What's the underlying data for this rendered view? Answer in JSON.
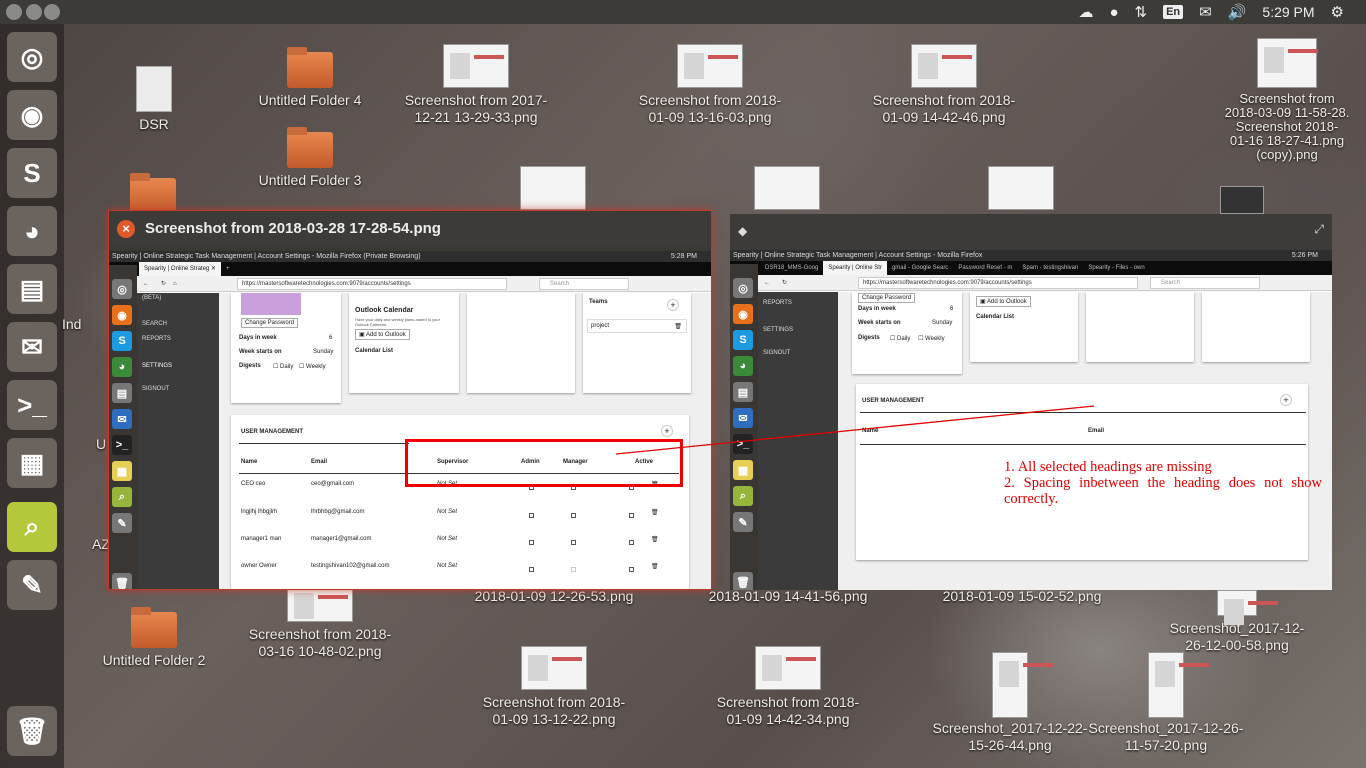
{
  "topbar": {
    "time": "5:29 PM",
    "lang": "En"
  },
  "desktop": {
    "icons": [
      {
        "label": "DSR",
        "kind": "doc"
      },
      {
        "label": "Untitled Folder 4",
        "kind": "folder"
      },
      {
        "label": "Screenshot from 2017-12-21 13-29-33.png",
        "kind": "shot"
      },
      {
        "label": "Screenshot from 2018-01-09 13-16-03.png",
        "kind": "shot"
      },
      {
        "label": "Screenshot from 2018-01-09 14-42-46.png",
        "kind": "shot"
      },
      {
        "label": "Untitled Folder 3",
        "kind": "folder"
      },
      {
        "label": "Screenshot from 2018-03-16 10-48-02.png",
        "kind": "shot"
      },
      {
        "label": "Untitled Folder 2",
        "kind": "folder"
      },
      {
        "label": "Screenshot from 2018-01-09 13-12-22.png",
        "kind": "shot"
      },
      {
        "label": "Screenshot from 2018-01-09 14-42-34.png",
        "kind": "shot"
      },
      {
        "label": "Screenshot_2017-12-22-15-26-44.png",
        "kind": "phone"
      },
      {
        "label": "Screenshot_2017-12-26-11-57-20.png",
        "kind": "phone"
      },
      {
        "label": "Screenshot_2017-12-26-12-00-58.png",
        "kind": "shot"
      },
      {
        "label": "2018-01-09 12-26-53.png",
        "kind": "partial"
      },
      {
        "label": "2018-01-09 14-41-56.png",
        "kind": "partial"
      },
      {
        "label": "2018-01-09 15-02-52.png",
        "kind": "partial"
      }
    ],
    "stacked_labels": [
      "Screenshot from",
      "2018-03-09 11-58-28.",
      "Screenshot 2018-",
      "01-16 18-27-41.png",
      "(copy).png"
    ],
    "side_partial": [
      "Ind",
      "U",
      "AZ"
    ]
  },
  "window1": {
    "title": "Screenshot from 2018-03-28 17-28-54.png",
    "ff_title": "Spearity | Online Strategic Task Management | Account Settings - Mozilla Firefox (Private Browsing)",
    "ff_time": "5:28 PM",
    "tab": "Spearity | Online Strateg",
    "url": "https://mastersoftwaretechnologies.com:9079/accounts/settings",
    "search": "Search",
    "sidebar": {
      "beta": "(BETA)",
      "search": "SEARCH",
      "reports": "REPORTS",
      "settings": "SETTINGS",
      "signout": "SIGNOUT"
    },
    "profile": {
      "change_password": "Change Password",
      "days_in_week": "Days in week",
      "days_value": "6",
      "week_starts": "Week starts on",
      "week_value": "Sunday",
      "digests": "Digests",
      "daily": "Daily",
      "weekly": "Weekly"
    },
    "outlook": {
      "title": "Outlook Calendar",
      "desc": "Have your daily and weekly plans added to your Outlook Calendar",
      "add": "Add to Outlook",
      "list": "Calendar List"
    },
    "teams": {
      "title": "Teams",
      "project": "project"
    },
    "um": {
      "title": "USER MANAGEMENT",
      "cols": [
        "Name",
        "Email",
        "Supervisor",
        "Admin",
        "Manager",
        "Active"
      ],
      "rows": [
        {
          "name": "CEO ceo",
          "email": "ceo@gmail.com",
          "sup": "Not Set"
        },
        {
          "name": "lngjlhj lhbgjlrh",
          "email": "lhrbhbg@gmail.com",
          "sup": "Not Set"
        },
        {
          "name": "manager1 man",
          "email": "manager1@gmail.com",
          "sup": "Not Set"
        },
        {
          "name": "owner Owner",
          "email": "testingshivan102@gmail.com",
          "sup": "Not Set"
        }
      ]
    }
  },
  "window2": {
    "ff_title": "Spearity | Online Strategic Task Management | Account Settings - Mozilla Firefox",
    "ff_time": "5:26 PM",
    "tabs": [
      "DSR18_MMS-Goog",
      "Spearity | Online Str",
      "gmail - Google Searc",
      "Password Reset - m",
      "Spam - testingshivan",
      "Spearity - Files - own"
    ],
    "url": "https://mastersoftwaretechnologies.com:9079/accounts/settings",
    "search": "Search",
    "sidebar": {
      "reports": "REPORTS",
      "settings": "SETTINGS",
      "signout": "SIGNOUT"
    },
    "profile": {
      "change_password": "Change Password",
      "days_in_week": "Days in week",
      "days_value": "6",
      "week_starts": "Week starts on",
      "week_value": "Sunday",
      "digests": "Digests",
      "daily": "Daily",
      "weekly": "Weekly"
    },
    "outlook": {
      "add": "Add to Outlook",
      "list": "Calendar List"
    },
    "um": {
      "title": "USER MANAGEMENT",
      "cols": [
        "Name",
        "Email"
      ]
    }
  },
  "annotation": {
    "line1": "1. All selected headings are missing",
    "line2": "2. Spacing inbetween the heading does not show correctly.",
    "color": "#e00000"
  }
}
